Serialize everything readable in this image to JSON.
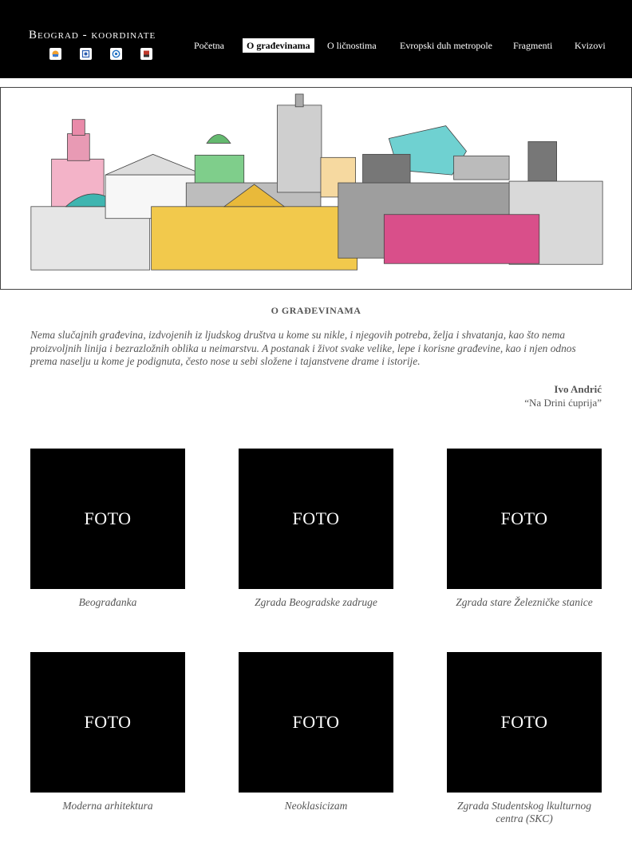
{
  "header": {
    "site_title": "Beograd - koordinate",
    "logos": [
      "logo-1-icon",
      "logo-2-icon",
      "logo-3-icon",
      "logo-4-icon"
    ],
    "nav": [
      {
        "label": "Početna",
        "active": false
      },
      {
        "label": "O građevinama",
        "active": true
      },
      {
        "label": "O ličnostima",
        "active": false
      },
      {
        "label": "Evropski duh metropole",
        "active": false
      },
      {
        "label": "Fragmenti",
        "active": false
      },
      {
        "label": "Kvizovi",
        "active": false
      }
    ]
  },
  "main": {
    "section_title": "O GRAĐEVINAMA",
    "quote": "Nema  slučajnih građevina, izdvojenih iz ljudskog društva u kome su nikle, i njegovih potreba, želja i shvatanja, kao što nema proizvoljnih linija i bezrazložnih oblika u neimarstvu. A postanak i život svake velike, lepe i korisne građevine, kao i njen odnos prema naselju u kome je podignuta, često nose u sebi složene i tajanstvene drame i istorije.",
    "author": "Ivo Andrić",
    "work": "“Na Drini ćuprija”"
  },
  "gallery": [
    {
      "photo_label": "FOTO",
      "caption": "Beograđanka"
    },
    {
      "photo_label": "FOTO",
      "caption": "Zgrada Beogradske zadruge"
    },
    {
      "photo_label": "FOTO",
      "caption": "Zgrada stare Železničke stanice"
    },
    {
      "photo_label": "FOTO",
      "caption": "Moderna arhitektura"
    },
    {
      "photo_label": "FOTO",
      "caption": "Neoklasicizam"
    },
    {
      "photo_label": "FOTO",
      "caption": "Zgrada Studentskog lkulturnog centra (SKC)"
    }
  ],
  "colors": {
    "header_bg": "#000000",
    "photo_bg": "#000000",
    "text": "#555555",
    "banner_yellow": "#f2c94c",
    "banner_pink": "#d94f8a",
    "banner_teal": "#5cc8c8",
    "banner_green": "#6cc07a"
  }
}
